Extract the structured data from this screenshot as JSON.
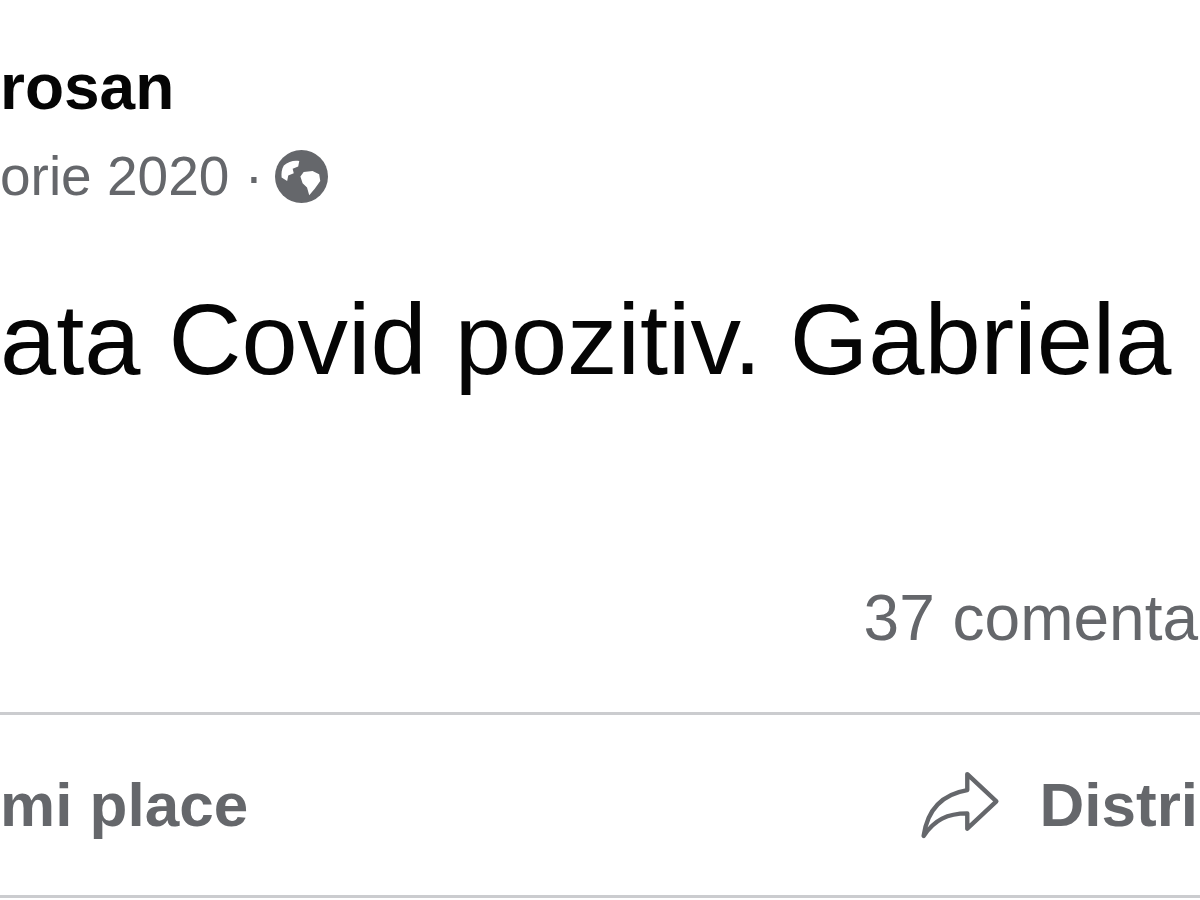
{
  "post": {
    "author": "rosan",
    "date": "orie 2020 ·",
    "text": "ata Covid pozitiv. Gabriela",
    "comments_count": "37 comenta"
  },
  "actions": [
    {
      "kind": "like",
      "label": "mi place"
    },
    {
      "kind": "share",
      "label": "Distri"
    }
  ]
}
